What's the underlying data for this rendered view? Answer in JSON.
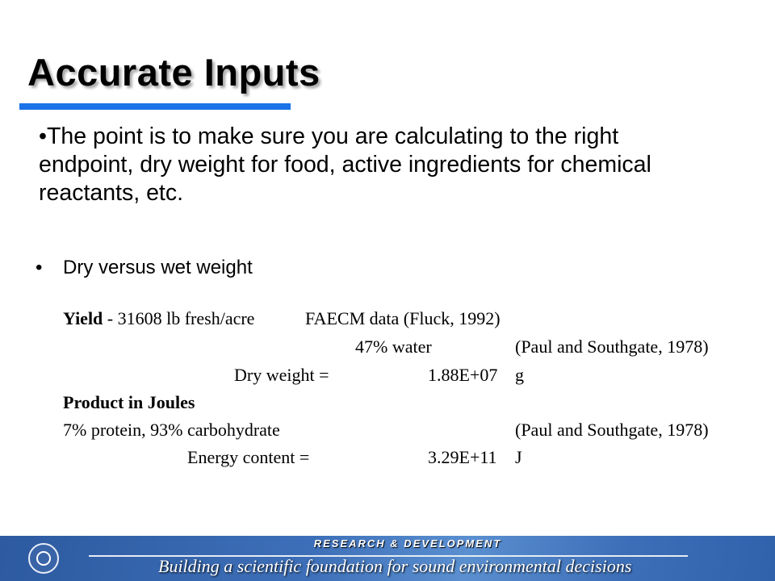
{
  "slide": {
    "title": "Accurate Inputs",
    "main_bullet": "•The point is to make sure you are calculating to the right endpoint, dry weight for food, active ingredients for chemical reactants, etc.",
    "sub_bullet_marker": "•",
    "sub_bullet": "Dry versus wet weight"
  },
  "table": {
    "yield_label": "Yield",
    "yield_value": " - 31608 lb fresh/acre",
    "yield_source": "FAECM data (Fluck, 1992)",
    "water_value": "47% water",
    "water_source": "(Paul and Southgate, 1978)",
    "dry_weight_label": "Dry weight =",
    "dry_weight_value": "1.88E+07",
    "dry_weight_unit": "g",
    "product_heading": "Product in Joules",
    "composition": "7% protein, 93% carbohydrate",
    "composition_source": "(Paul and Southgate, 1978)",
    "energy_label": "Energy content  =",
    "energy_value": "3.29E+11",
    "energy_unit": "J"
  },
  "footer": {
    "logo_icon": "epa-seal-icon",
    "top_text": "RESEARCH & DEVELOPMENT",
    "bottom_text": "Building a scientific foundation for sound environmental decisions"
  },
  "colors": {
    "title_underline": "#1a73e8",
    "footer_band": "#3d6fb8"
  }
}
